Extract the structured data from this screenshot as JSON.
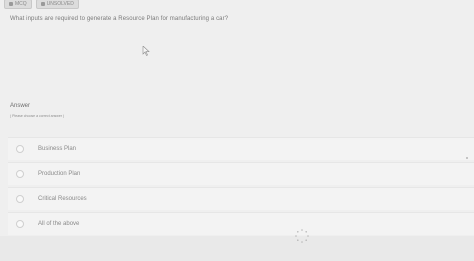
{
  "topbar": {
    "tag1_label": "MCQ",
    "tag2_label": "UNSOLVED"
  },
  "question": {
    "text": "What inputs are required to generate a Resource Plan for manufacturing a car?"
  },
  "answer": {
    "label": "Answer",
    "hint": "( Please choose a correct answer )"
  },
  "options": [
    {
      "label": "Business Plan"
    },
    {
      "label": "Production Plan"
    },
    {
      "label": "Critical Resources"
    },
    {
      "label": "All of the above"
    }
  ],
  "icons": {
    "cursor": "pointer-cursor-icon",
    "spinner": "loading-spinner-icon"
  }
}
